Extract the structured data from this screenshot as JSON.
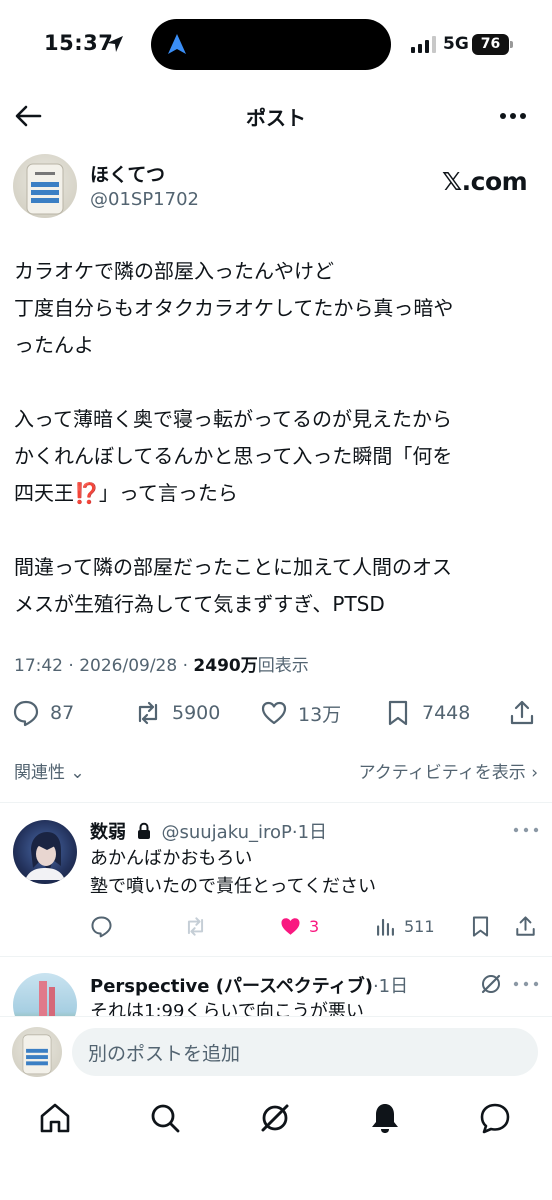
{
  "status_bar": {
    "time": "15:37",
    "network": "5G",
    "battery": "76"
  },
  "header": {
    "title": "ポスト",
    "back_icon": "arrow-left-icon",
    "more_icon": "more-horizontal-icon"
  },
  "author": {
    "name": "ほくてつ",
    "handle": "@01SP1702",
    "watermark": "𝕏.com"
  },
  "tweet": {
    "paragraphs": [
      [
        "カラオケで隣の部屋入ったんやけど",
        "丁度自分らもオタクカラオケしてたから真っ暗や",
        "ったんよ"
      ],
      [
        "入って薄暗く奥で寝っ転がってるのが見えたから",
        "かくれんぼしてるんかと思って入った瞬間「何を"
      ],
      [
        "間違って隣の部屋だったことに加えて人間のオス",
        "メスが生殖行為してて気まずすぎ、PTSD"
      ]
    ],
    "line_p2_3_prefix": "四天王",
    "line_p2_3_emoji": "⁉️",
    "line_p2_3_suffix": "」って言ったら",
    "timestamp": "17:42 · 2026/09/28 · ",
    "views_count": "2490万",
    "views_label": "回表示"
  },
  "actions": {
    "replies": "87",
    "reposts": "5900",
    "likes": "13万",
    "bookmarks": "7448"
  },
  "sort": {
    "relevance": "関連性",
    "activity": "アクティビティを表示"
  },
  "replies": [
    {
      "name": "数弱",
      "handle": "@suujaku_iroP",
      "time": "·1日",
      "lines": [
        "あかんばかおもろい",
        "塾で噴いたので責任とってください"
      ],
      "likes": "3",
      "views": "511"
    },
    {
      "name": "Perspective (パースペクティブ)",
      "handle": "",
      "time": "·1日",
      "lines": [
        "それは1:99くらいで向こうが悪い"
      ]
    }
  ],
  "compose": {
    "placeholder": "別のポストを追加"
  },
  "nav": [
    "home-icon",
    "search-icon",
    "grok-icon",
    "notifications-icon",
    "messages-icon"
  ]
}
